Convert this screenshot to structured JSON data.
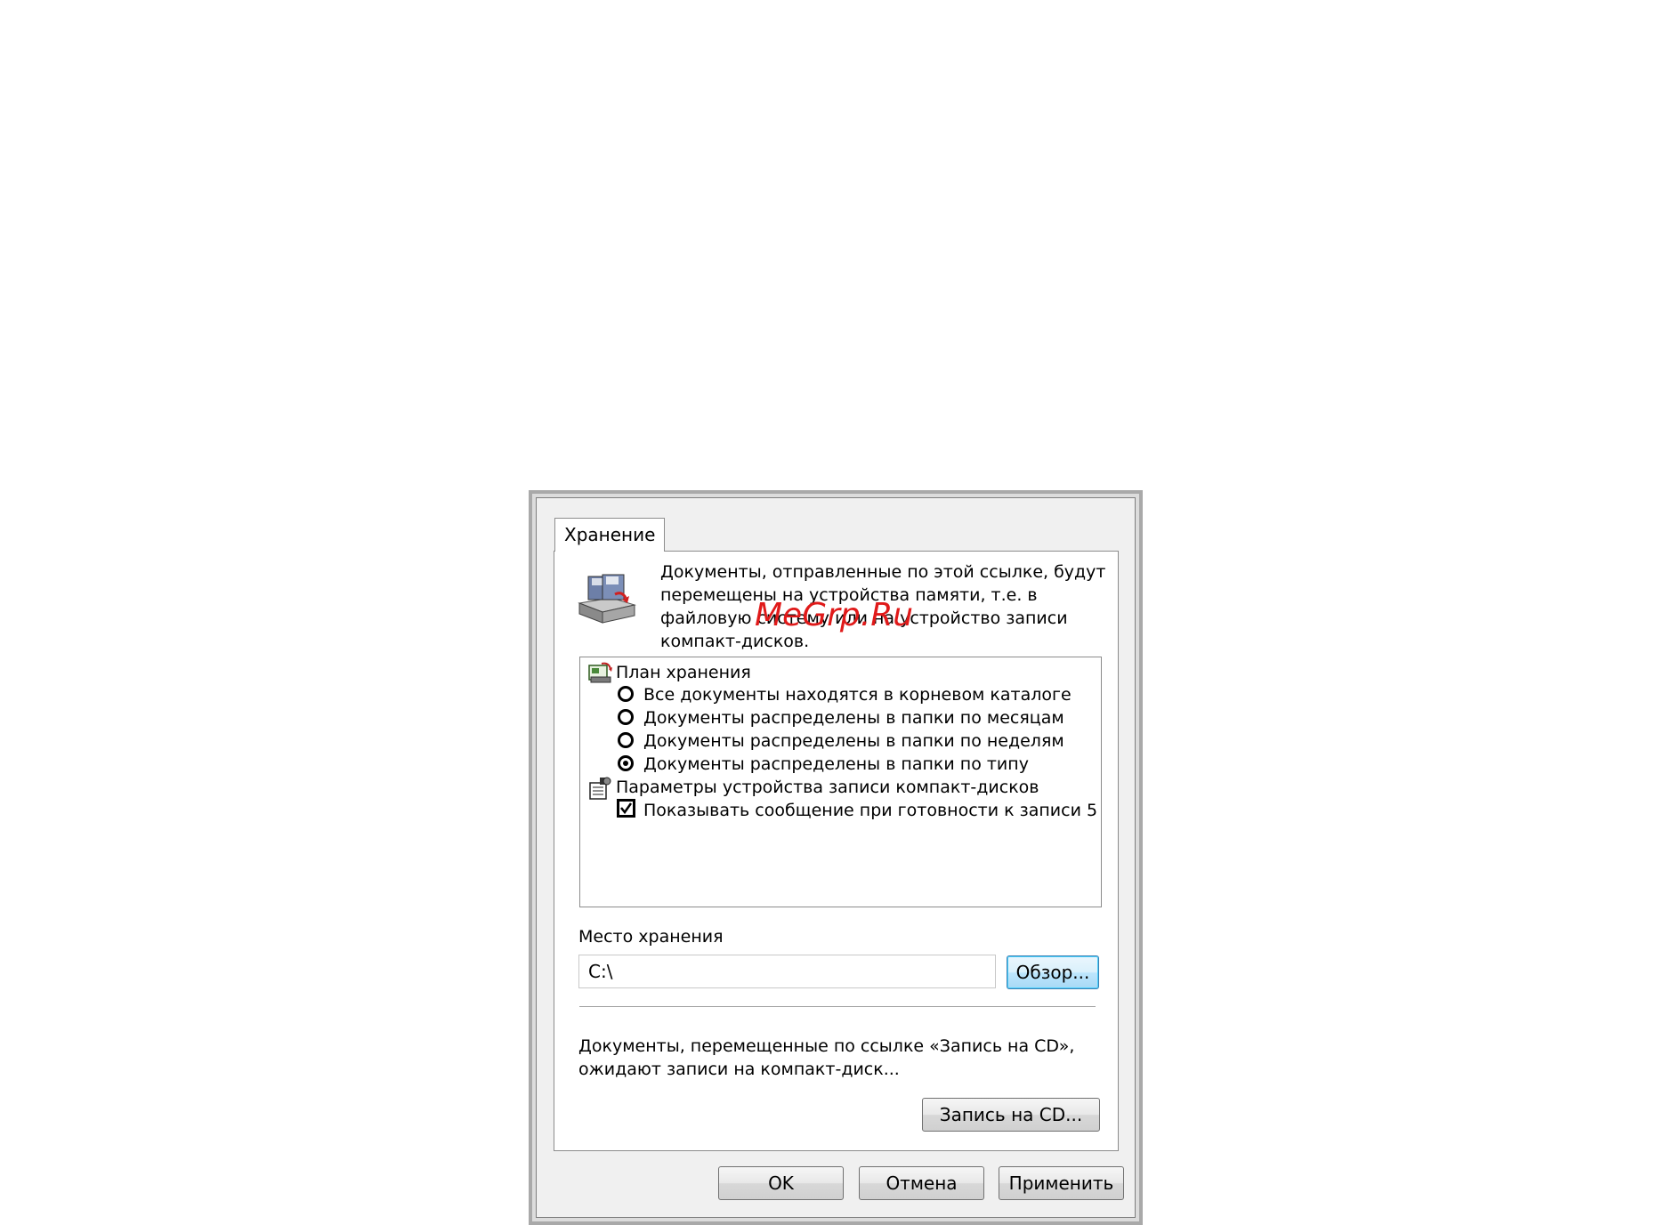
{
  "watermark": "MeGrp.Ru",
  "dialog": {
    "tab_label": "Хранение",
    "description": "Документы, отправленные по этой ссылке, будут перемещены на устройства памяти, т.е. в файловую систему или на устройство записи компакт-дисков.",
    "tree": {
      "group1_label": "План хранения",
      "options": [
        {
          "label": "Все документы находятся в корневом каталоге",
          "selected": false
        },
        {
          "label": "Документы распределены в папки по месяцам",
          "selected": false
        },
        {
          "label": "Документы распределены в папки по неделям",
          "selected": false
        },
        {
          "label": "Документы распределены в папки по типу",
          "selected": true
        }
      ],
      "group2_label": "Параметры устройства записи компакт-дисков",
      "checkbox_label": "Показывать сообщение при готовности к записи 5",
      "checkbox_checked": true
    },
    "location_label": "Место хранения",
    "location_value": "C:\\",
    "browse_label": "Обзор...",
    "cd_note": "Документы, перемещенные по ссылке «Запись на CD», ожидают записи на компакт-диск...",
    "burn_label": "Запись на CD...",
    "ok_label": "OK",
    "cancel_label": "Отмена",
    "apply_label": "Применить"
  }
}
